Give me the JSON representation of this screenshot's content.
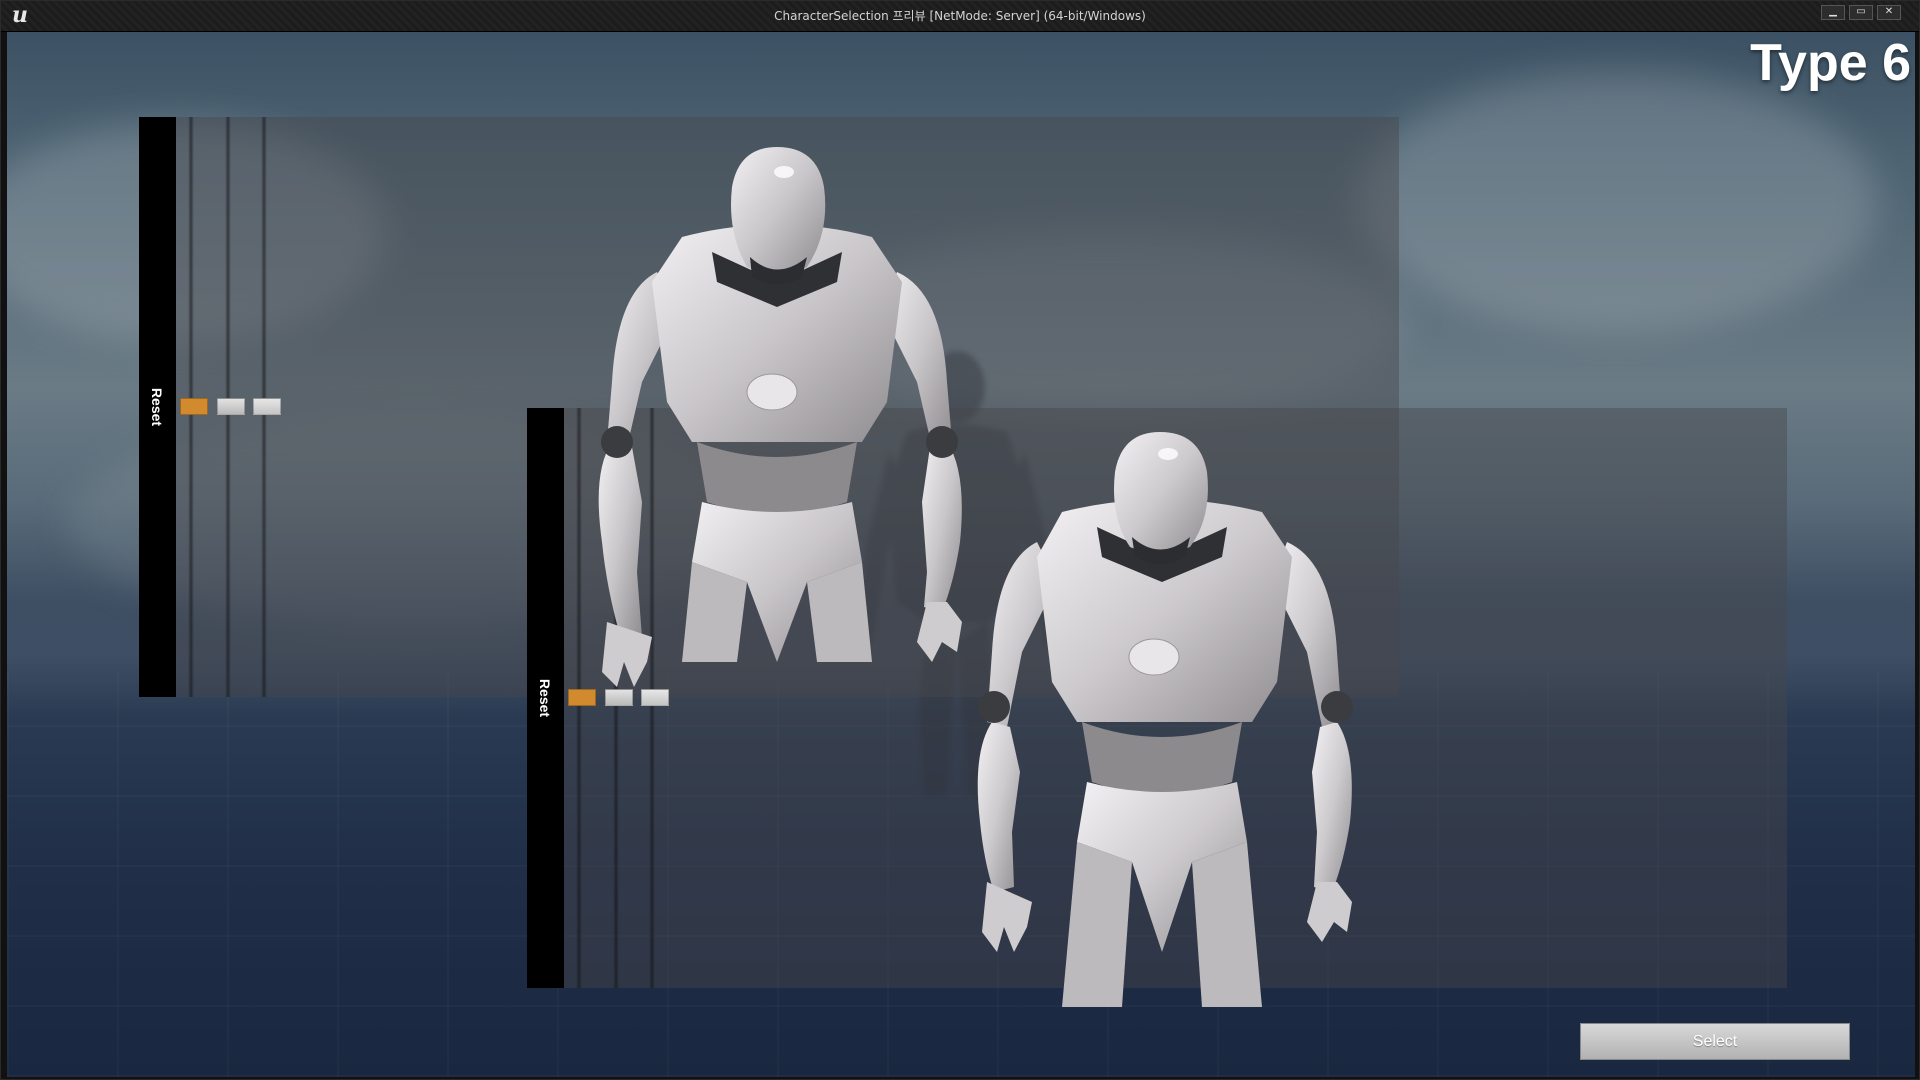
{
  "window": {
    "title": "CharacterSelection 프리뷰 [NetMode: Server] (64-bit/Windows)",
    "logo_icon": "unreal-engine-logo",
    "logo_glyph": "u",
    "controls": {
      "minimize_glyph": "▁",
      "maximize_glyph": "▭",
      "close_glyph": "✕"
    }
  },
  "header": {
    "title": "Type 6"
  },
  "panels": [
    {
      "reset_label": "Reset",
      "swatches": [
        "#d18a2e",
        "#c9c9c9",
        "#d4d4d4"
      ]
    },
    {
      "reset_label": "Reset",
      "swatches": [
        "#d18a2e",
        "#c9c9c9",
        "#d4d4d4"
      ]
    }
  ],
  "footer": {
    "select_label": "Select"
  },
  "colors": {
    "robot_body": "#d6d3d5",
    "robot_joint": "#3a3c40",
    "accent_swatch": "#d18a2e"
  }
}
